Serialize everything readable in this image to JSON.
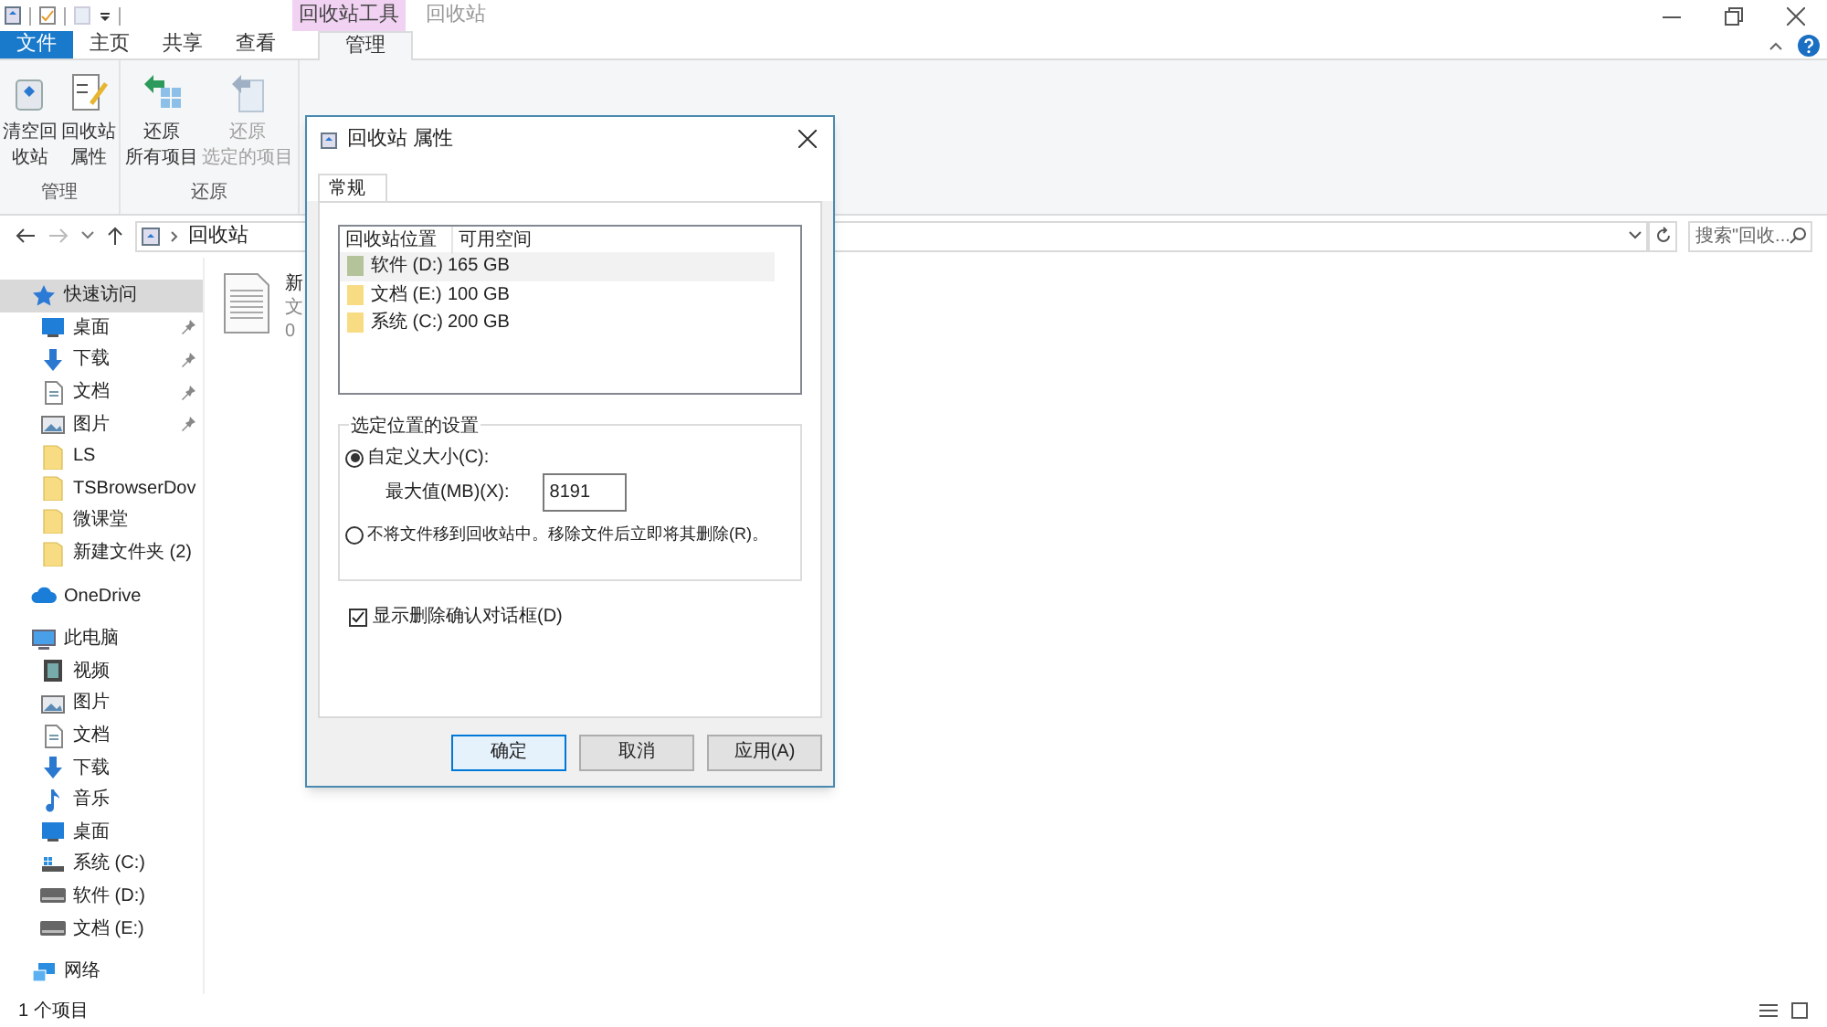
{
  "window": {
    "title": "回收站",
    "context_tab_group": "回收站工具"
  },
  "ribbon_tabs": [
    {
      "label": "文件",
      "kind": "file",
      "selected": false
    },
    {
      "label": "主页",
      "kind": "tab",
      "selected": false
    },
    {
      "label": "共享",
      "kind": "tab",
      "selected": false
    },
    {
      "label": "查看",
      "kind": "tab",
      "selected": false
    },
    {
      "label": "管理",
      "kind": "tab",
      "selected": true
    }
  ],
  "ribbon_groups": [
    {
      "name": "管理",
      "buttons": [
        {
          "lines": [
            "清空回",
            "收站"
          ],
          "kind": "empty-bin",
          "disabled": false
        },
        {
          "lines": [
            "回收站",
            "属性"
          ],
          "kind": "properties",
          "disabled": false
        }
      ]
    },
    {
      "name": "还原",
      "buttons": [
        {
          "lines": [
            "还原",
            "所有项目"
          ],
          "kind": "restore-all",
          "disabled": false
        },
        {
          "lines": [
            "还原",
            "选定的项目"
          ],
          "kind": "restore-selected",
          "disabled": true
        }
      ]
    }
  ],
  "address_bar": {
    "path": "回收站",
    "search_placeholder": "搜索\"回收..."
  },
  "sidebar": {
    "items": [
      {
        "label": "快速访问",
        "kind": "star",
        "selected": true,
        "children": [
          {
            "label": "桌面",
            "kind": "desktop",
            "pinned": true,
            "selected": false
          },
          {
            "label": "下载",
            "kind": "download",
            "pinned": true,
            "selected": false
          },
          {
            "label": "文档",
            "kind": "document",
            "pinned": true,
            "selected": false
          },
          {
            "label": "图片",
            "kind": "picture",
            "pinned": true,
            "selected": false
          },
          {
            "label": "LS",
            "kind": "folder",
            "pinned": false,
            "selected": false
          },
          {
            "label": "TSBrowserDov",
            "kind": "folder",
            "pinned": false,
            "selected": false
          },
          {
            "label": "微课堂",
            "kind": "folder",
            "pinned": false,
            "selected": false
          },
          {
            "label": "新建文件夹 (2)",
            "kind": "folder",
            "pinned": false,
            "selected": false
          }
        ]
      },
      {
        "label": "OneDrive",
        "kind": "cloud",
        "selected": false
      },
      {
        "label": "此电脑",
        "kind": "pc",
        "selected": false,
        "children": [
          {
            "label": "视频",
            "kind": "video",
            "pinned": false,
            "selected": false
          },
          {
            "label": "图片",
            "kind": "picture",
            "pinned": false,
            "selected": false
          },
          {
            "label": "文档",
            "kind": "document",
            "pinned": false,
            "selected": false
          },
          {
            "label": "下载",
            "kind": "download",
            "pinned": false,
            "selected": false
          },
          {
            "label": "音乐",
            "kind": "music",
            "pinned": false,
            "selected": false
          },
          {
            "label": "桌面",
            "kind": "desktop",
            "pinned": false,
            "selected": false
          },
          {
            "label": "系统 (C:)",
            "kind": "system-drive",
            "pinned": false,
            "selected": false
          },
          {
            "label": "软件 (D:)",
            "kind": "drive",
            "pinned": false,
            "selected": false
          },
          {
            "label": "文档 (E:)",
            "kind": "drive",
            "pinned": false,
            "selected": false
          }
        ]
      },
      {
        "label": "网络",
        "kind": "network",
        "selected": false
      }
    ]
  },
  "files": [
    {
      "name": "新",
      "type": "文",
      "size": "0"
    }
  ],
  "status_bar": {
    "item_count": "1 个项目"
  },
  "dialog": {
    "title": "回收站 属性",
    "tabs": [
      {
        "label": "常规",
        "selected": true
      }
    ],
    "locations": {
      "columns": [
        "回收站位置",
        "可用空间"
      ],
      "rows": [
        {
          "location": "软件 (D:)",
          "space": "165 GB",
          "selected": true,
          "color": "#b4c39a"
        },
        {
          "location": "文档 (E:)",
          "space": "100 GB",
          "selected": false,
          "color": "#f8dc84"
        },
        {
          "location": "系统 (C:)",
          "space": "200 GB",
          "selected": false,
          "color": "#f8dc84"
        }
      ]
    },
    "settings": {
      "title": "选定位置的设置",
      "custom_size": {
        "label": "自定义大小(C):",
        "selected": true
      },
      "max_size": {
        "label": "最大值(MB)(X):",
        "value": "8191"
      },
      "delete_immediately": {
        "label": "不将文件移到回收站中。移除文件后立即将其删除(R)。",
        "selected": false
      }
    },
    "confirm_dialog": {
      "label": "显示删除确认对话框(D)",
      "checked": true
    },
    "buttons": [
      {
        "label": "确定",
        "default": true
      },
      {
        "label": "取消",
        "default": false
      },
      {
        "label": "应用(A)",
        "default": false
      }
    ]
  }
}
